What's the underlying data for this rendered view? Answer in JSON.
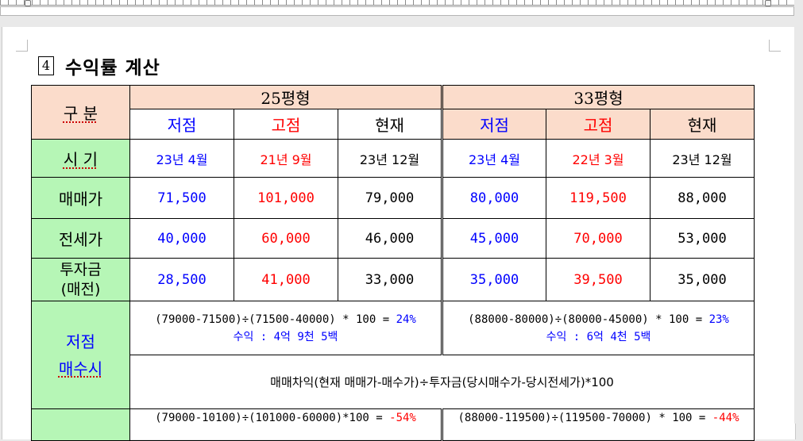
{
  "section": {
    "number": "4",
    "title": "수익률 계산"
  },
  "table": {
    "group_label": "구 분",
    "groups": [
      {
        "name": "25평형"
      },
      {
        "name": "33평형"
      }
    ],
    "subheaders": [
      "저점",
      "고점",
      "현재",
      "저점",
      "고점",
      "현재"
    ],
    "rows": [
      {
        "label": "시 기",
        "cells": [
          "23년 4월",
          "21년 9월",
          "23년 12월",
          "23년 4월",
          "22년 3월",
          "23년 12월"
        ]
      },
      {
        "label": "매매가",
        "cells": [
          "71,500",
          "101,000",
          "79,000",
          "80,000",
          "119,500",
          "88,000"
        ]
      },
      {
        "label": "전세가",
        "cells": [
          "40,000",
          "60,000",
          "46,000",
          "45,000",
          "70,000",
          "53,000"
        ]
      },
      {
        "label_line1": "투자금",
        "label_line2": "(매전)",
        "cells": [
          "28,500",
          "41,000",
          "33,000",
          "35,000",
          "39,500",
          "35,000"
        ]
      }
    ],
    "low_buy": {
      "label_line1": "저점",
      "label_line2": "매수시",
      "f25_prefix": "(79000-71500)÷(71500-40000) * 100 = ",
      "f25_pct": "24%",
      "f25_profit": "수익 : 4억 9천 5백",
      "f33_prefix": "(88000-80000)÷(80000-45000) * 100 = ",
      "f33_pct": "23%",
      "f33_profit": "수익 : 6억 4천 5백",
      "general": "매매차익(현재 매매가-매수가)÷투자금(당시매수가-당시전세가)*100"
    },
    "high_buy": {
      "f25_prefix": "(79000-10100)÷(101000-60000)*100 = ",
      "f25_pct": "-54%",
      "f33_prefix": "(88000-119500)÷(119500-70000) * 100 = ",
      "f33_pct": "-44%"
    }
  },
  "colors": {
    "peach": "#fbdccb",
    "green": "#b6f6b6",
    "blue": "#0000ff",
    "red": "#ff0000"
  }
}
